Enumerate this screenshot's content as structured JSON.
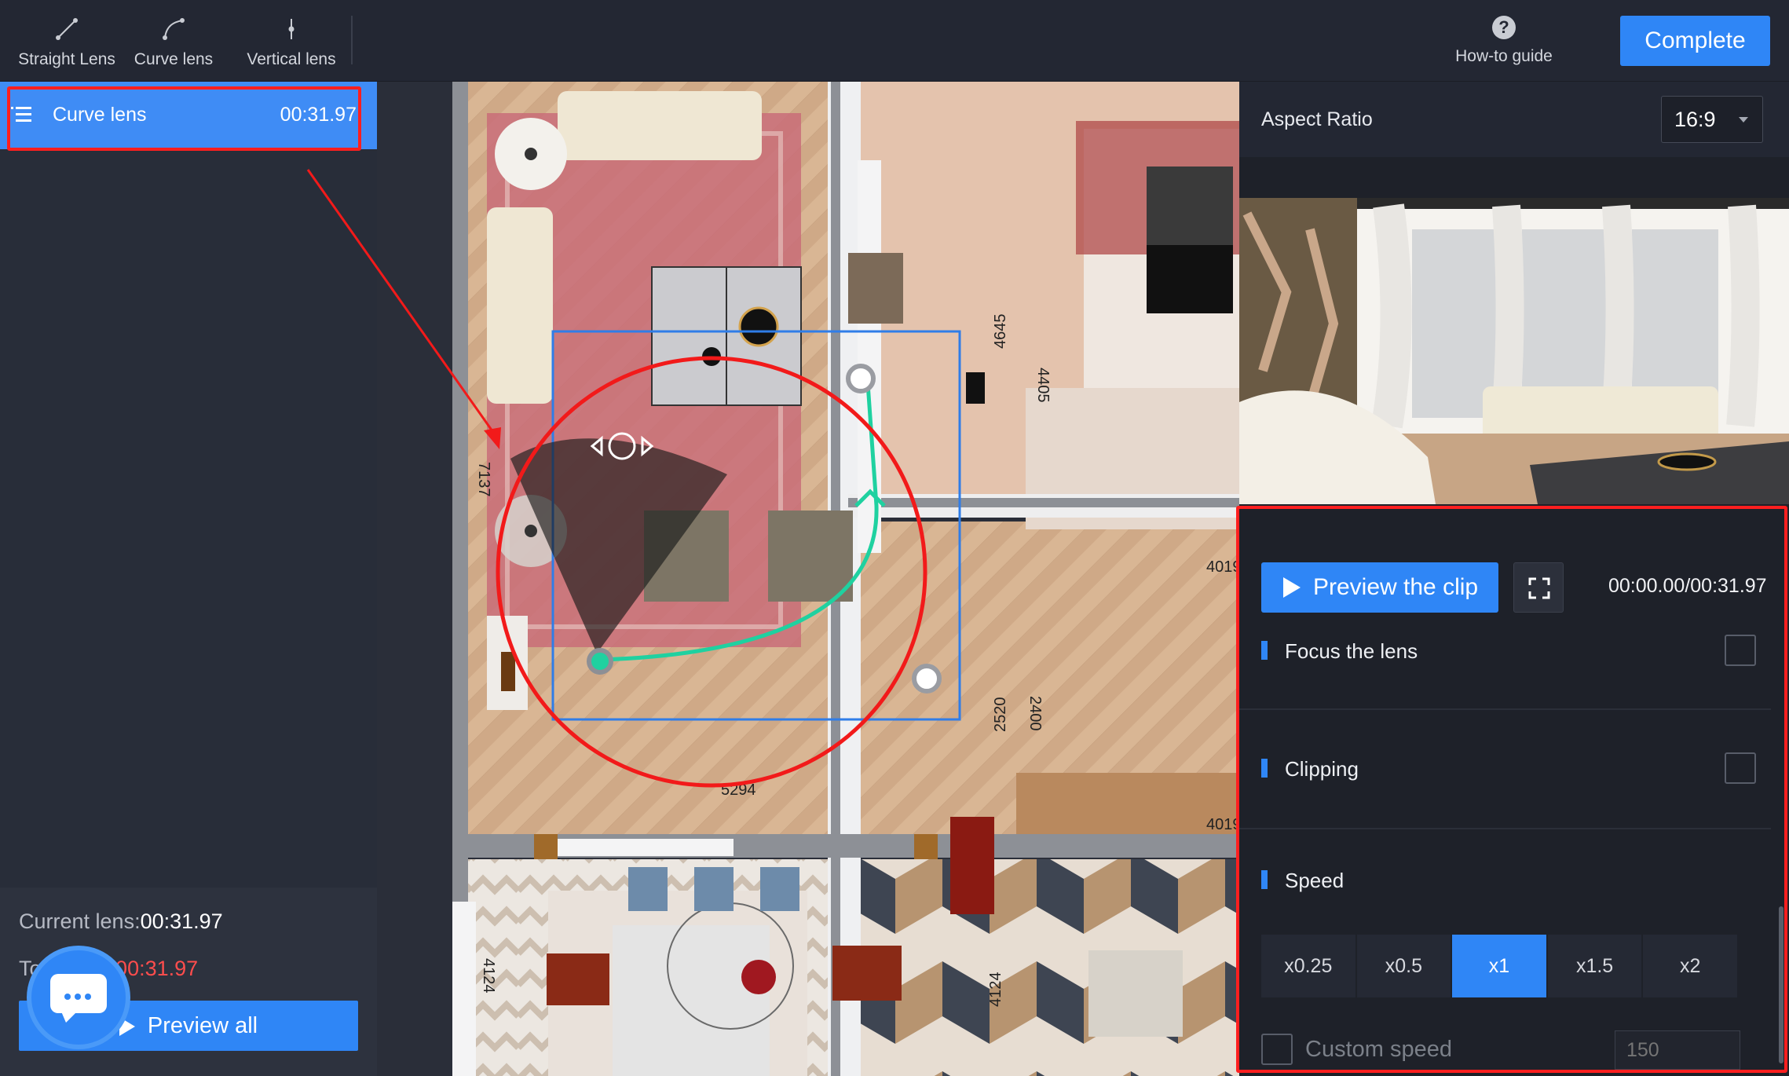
{
  "toolbar": {
    "straight_lens": "Straight Lens",
    "curve_lens": "Curve lens",
    "vertical_lens": "Vertical lens",
    "help": "How-to guide",
    "complete": "Complete"
  },
  "sidebar": {
    "lens": {
      "name": "Curve lens",
      "time": "00:31.97"
    },
    "current_label": "Current lens:",
    "current_value": "00:31.97",
    "total_label": "Total time:",
    "total_value": "00:31.97",
    "preview_all": "Preview all"
  },
  "plan": {
    "dims": {
      "d4645": "4645",
      "d4405": "4405",
      "d7137": "7137",
      "d4019a": "4019",
      "d4019b": "4019",
      "d2520": "2520",
      "d2400": "2400",
      "d5294": "5294",
      "d4124a": "4124",
      "d4124b": "4124"
    }
  },
  "panel": {
    "aspect_label": "Aspect Ratio",
    "aspect_value": "16:9",
    "preview_clip": "Preview the clip",
    "clip_time": "00:00.00/00:31.97",
    "focus": "Focus the lens",
    "clipping": "Clipping",
    "speed": "Speed",
    "speeds": [
      "x0.25",
      "x0.5",
      "x1",
      "x1.5",
      "x2"
    ],
    "active_speed": "x1",
    "custom_speed": "Custom speed",
    "custom_placeholder": "150"
  },
  "colors": {
    "accent": "#2f86f6",
    "highlight": "#ff1f1f",
    "camera_path": "#1fd1a0"
  }
}
